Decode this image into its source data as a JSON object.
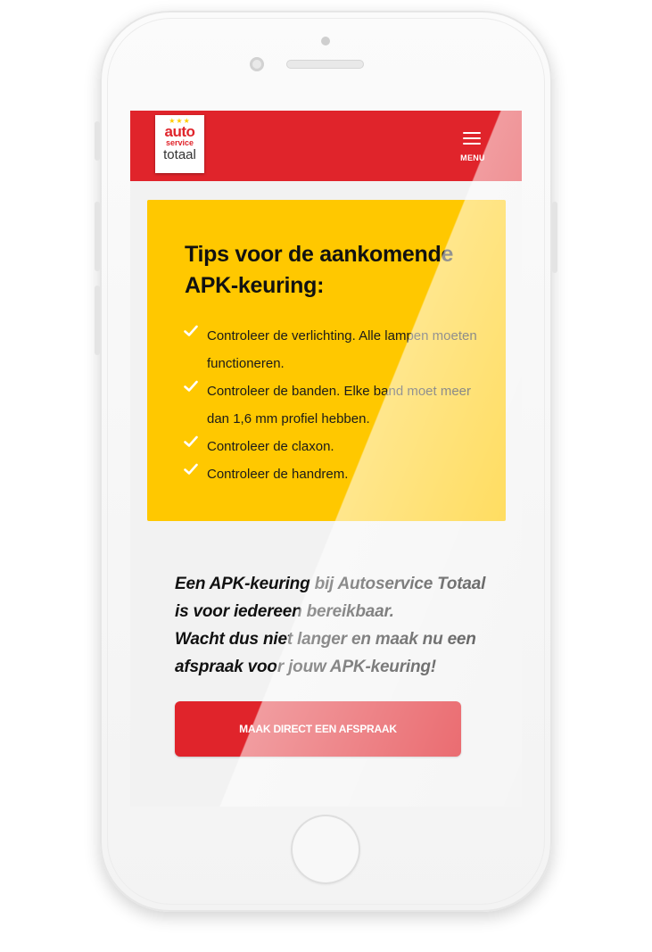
{
  "header": {
    "logo": {
      "stars": "★★★",
      "line1": "auto",
      "line2": "service",
      "line3": "totaal"
    },
    "menu_label": "MENU"
  },
  "tips": {
    "title": "Tips voor de aankomende APK-keuring:",
    "items": [
      {
        "icon": "check-icon",
        "text": "Controleer de verlichting. Alle lampen moeten functioneren."
      },
      {
        "icon": "check-icon",
        "text": "Controleer de banden. Elke band moet meer dan 1,6 mm profiel hebben."
      },
      {
        "icon": "check-icon",
        "text": "Controleer de claxon."
      },
      {
        "icon": "check-icon",
        "text": "Controleer de handrem."
      }
    ]
  },
  "cta": {
    "line1": "Een APK-keuring bij Autoservice Totaal",
    "line2": "is voor iedereen bereikbaar.",
    "line3": "Wacht dus niet langer en maak nu een",
    "line4": "afspraak voor jouw APK-keuring!",
    "button_label": "MAAK DIRECT EEN AFSPRAAK"
  },
  "colors": {
    "brand_red": "#e0242b",
    "tips_yellow": "#ffc800",
    "screen_bg": "#f2f2f2"
  }
}
